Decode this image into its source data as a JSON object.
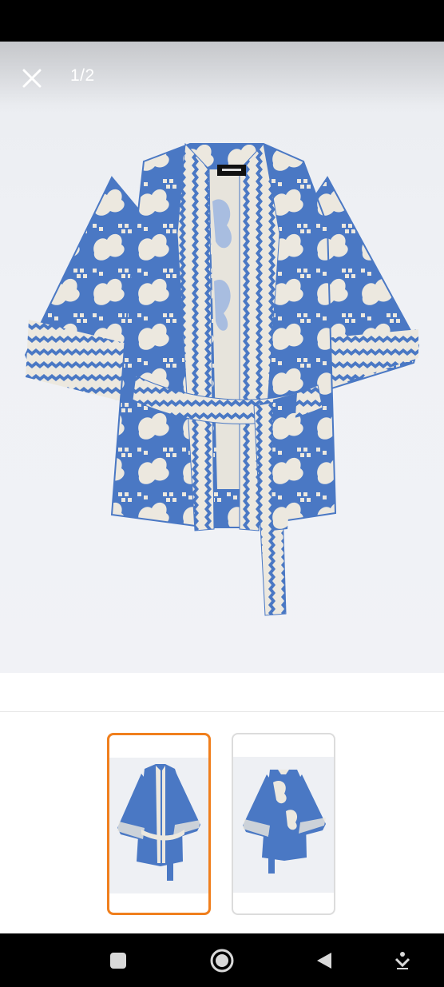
{
  "viewer": {
    "counter": "1/2",
    "close_icon": "close-icon",
    "product": "blue-white-printed-kimono-jacket"
  },
  "thumbnails": [
    {
      "name": "front-view",
      "selected": true
    },
    {
      "name": "back-view",
      "selected": false
    }
  ],
  "colors": {
    "accent": "#f07f1d",
    "fabric_blue": "#4a78c4",
    "fabric_cream": "#ece8df"
  },
  "nav": {
    "recents_icon": "square-icon",
    "home_icon": "circle-icon",
    "back_icon": "triangle-back-icon",
    "extra_icon": "down-arrow-icon"
  }
}
